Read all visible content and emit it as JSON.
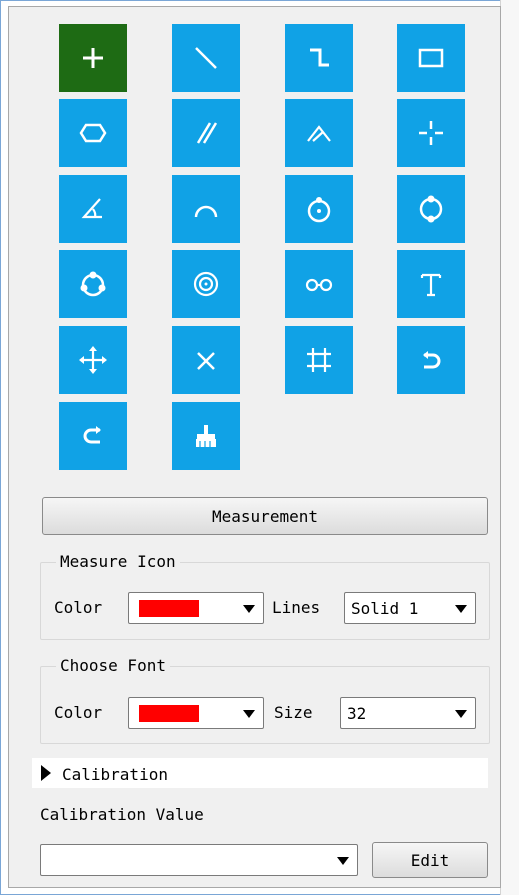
{
  "tools": [
    {
      "name": "crosshair-add-icon",
      "active": true
    },
    {
      "name": "line-icon"
    },
    {
      "name": "polyline-icon"
    },
    {
      "name": "rectangle-icon"
    },
    {
      "name": "polygon-icon"
    },
    {
      "name": "parallel-lines-icon"
    },
    {
      "name": "angle-vertex-icon"
    },
    {
      "name": "center-cross-icon"
    },
    {
      "name": "angle-icon"
    },
    {
      "name": "arc-icon"
    },
    {
      "name": "circle-center-icon"
    },
    {
      "name": "circle-two-point-icon"
    },
    {
      "name": "circle-three-point-icon"
    },
    {
      "name": "concentric-circles-icon"
    },
    {
      "name": "two-circles-icon"
    },
    {
      "name": "text-icon"
    },
    {
      "name": "move-icon"
    },
    {
      "name": "delete-icon"
    },
    {
      "name": "crop-icon"
    },
    {
      "name": "undo-icon"
    },
    {
      "name": "redo-icon"
    },
    {
      "name": "clear-brush-icon"
    }
  ],
  "measurement_button": "Measurement",
  "measure_icon": {
    "title": "Measure Icon",
    "color_label": "Color",
    "color_value": "#ff0000",
    "lines_label": "Lines",
    "lines_value": "Solid 1"
  },
  "choose_font": {
    "title": "Choose Font",
    "color_label": "Color",
    "color_value": "#ff0000",
    "size_label": "Size",
    "size_value": "32"
  },
  "calibration": {
    "header": "Calibration",
    "value_label": "Calibration Value",
    "selected_value": "",
    "edit_button": "Edit"
  }
}
